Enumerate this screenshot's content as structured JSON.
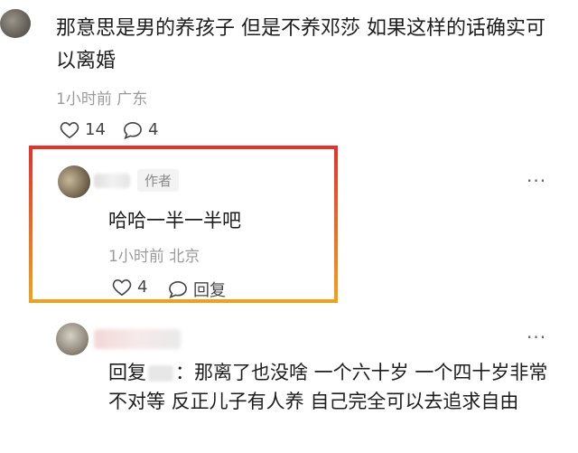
{
  "top_comment": {
    "text": "那意思是男的养孩子 但是不养邓莎 如果这样的话确实可以离婚",
    "meta": "1小时前 广东",
    "likes": "14",
    "comments": "4"
  },
  "reply_author": {
    "badge": "作者",
    "text": "哈哈一半一半吧",
    "meta": "1小时前 北京",
    "likes": "4",
    "reply_label": "回复"
  },
  "reply_two": {
    "prefix": "回复",
    "suffix": "：那离了也没啥 一个六十岁 一个四十岁非常不对等 反正儿子有人养 自己完全可以去追求自由"
  },
  "more_symbol": "···",
  "colors": {
    "highlight_top": "#e5322a",
    "highlight_bottom": "#f0a11c"
  }
}
